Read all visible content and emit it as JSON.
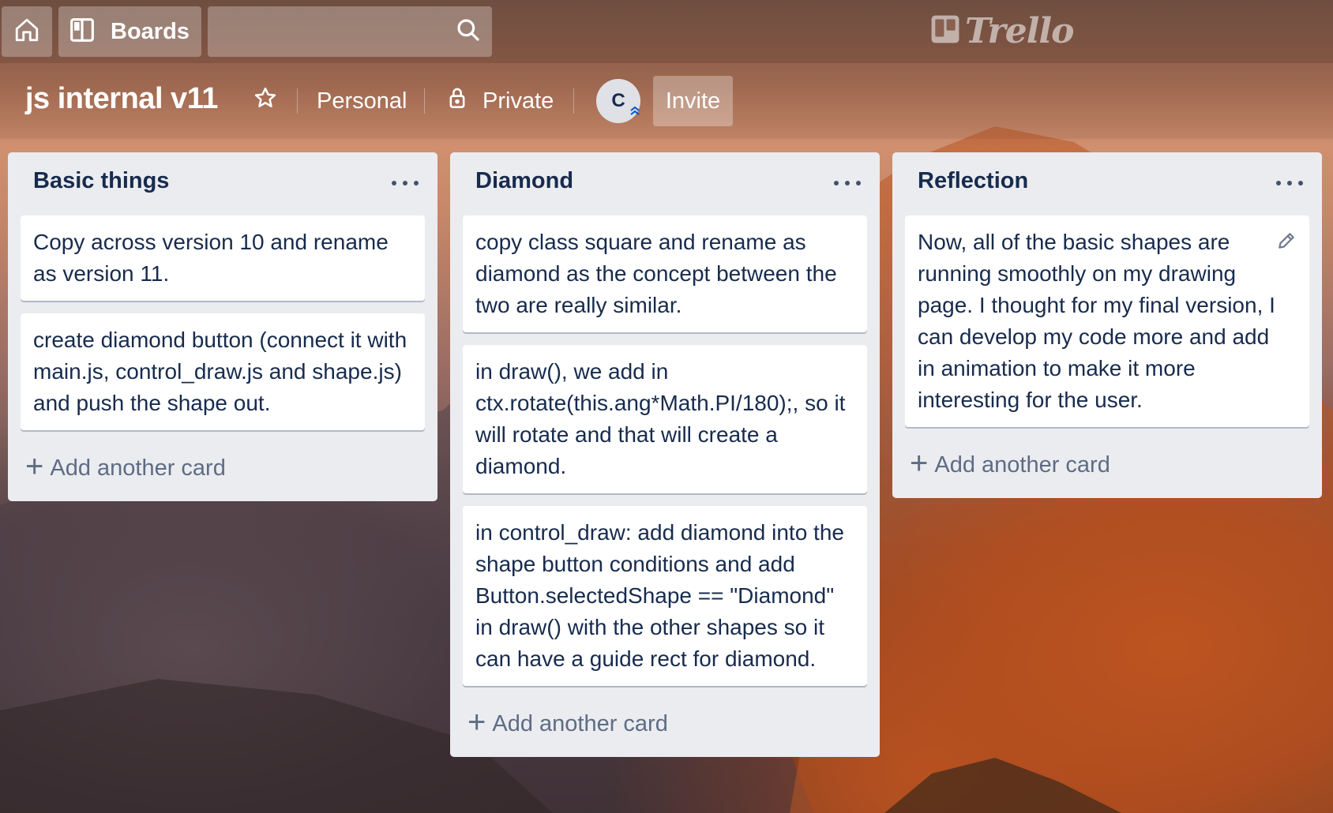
{
  "header": {
    "home_icon": "home-icon",
    "boards_label": "Boards",
    "boards_icon": "board-icon",
    "search_icon": "search-icon",
    "logo_text": "Trello"
  },
  "board": {
    "title": "js internal v11",
    "star_icon": "star-icon",
    "team": "Personal",
    "visibility": "Private",
    "visibility_icon": "lock-icon",
    "member_initial": "C",
    "invite_label": "Invite"
  },
  "lists": [
    {
      "title": "Basic things",
      "cards": [
        "Copy across version 10 and rename as version 11.",
        "create diamond button (connect it with main.js, control_draw.js and shape.js) and push the shape out."
      ],
      "add_label": "Add another card"
    },
    {
      "title": "Diamond",
      "cards": [
        "copy class square and rename as diamond as the concept between the two are really similar.",
        "in draw(), we add in ctx.rotate(this.ang*Math.PI/180);, so it will rotate and that will create a diamond.",
        "in control_draw: add diamond into the shape button conditions and add Button.selectedShape == \"Diamond\" in draw() with the other shapes so it can have a guide rect for diamond."
      ],
      "add_label": "Add another card"
    },
    {
      "title": "Reflection",
      "cards": [
        "Now, all of the basic shapes are running smoothly on my drawing page. I thought for my final version, I can develop my code more and add in animation to make it more interesting for the user."
      ],
      "add_label": "Add another card"
    }
  ],
  "colors": {
    "list_bg": "#ebecf0",
    "card_text": "#172b4d",
    "muted_text": "#5e6c84"
  }
}
